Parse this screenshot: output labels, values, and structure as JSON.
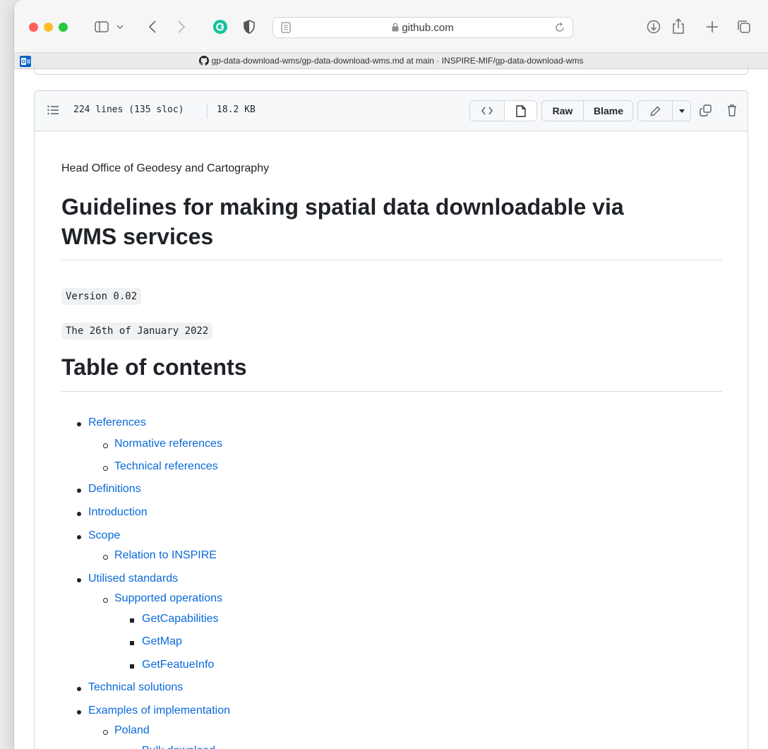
{
  "browser": {
    "url": "github.com",
    "tab_title": "gp-data-download-wms/gp-data-download-wms.md at main · INSPIRE-MIF/gp-data-download-wms"
  },
  "file": {
    "lines": "224 lines (135 sloc)",
    "size": "18.2 KB",
    "raw_label": "Raw",
    "blame_label": "Blame"
  },
  "doc": {
    "org": "Head Office of Geodesy and Cartography",
    "title_line1": "Guidelines for making spatial data downloadable via",
    "title_line2": "WMS services",
    "version": "Version 0.02",
    "date": "The 26th of January 2022",
    "toc_heading": "Table of contents"
  },
  "toc": [
    {
      "label": "References",
      "level": 1
    },
    {
      "label": "Normative references",
      "level": 2
    },
    {
      "label": "Technical references",
      "level": 2
    },
    {
      "label": "Definitions",
      "level": 1
    },
    {
      "label": "Introduction",
      "level": 1
    },
    {
      "label": "Scope",
      "level": 1
    },
    {
      "label": "Relation to INSPIRE",
      "level": 2
    },
    {
      "label": "Utilised standards",
      "level": 1
    },
    {
      "label": "Supported operations",
      "level": 2
    },
    {
      "label": "GetCapabilities",
      "level": 3
    },
    {
      "label": "GetMap",
      "level": 3
    },
    {
      "label": "GetFeatueInfo",
      "level": 3
    },
    {
      "label": "Technical solutions",
      "level": 1
    },
    {
      "label": "Examples of implementation",
      "level": 1
    },
    {
      "label": "Poland",
      "level": 2
    },
    {
      "label": "Bulk download",
      "level": 3
    }
  ],
  "colors": {
    "link": "#0969da",
    "close": "#ff5f57",
    "minimize": "#febc2e",
    "zoom": "#28c840",
    "grammarly": "#15c39a"
  }
}
